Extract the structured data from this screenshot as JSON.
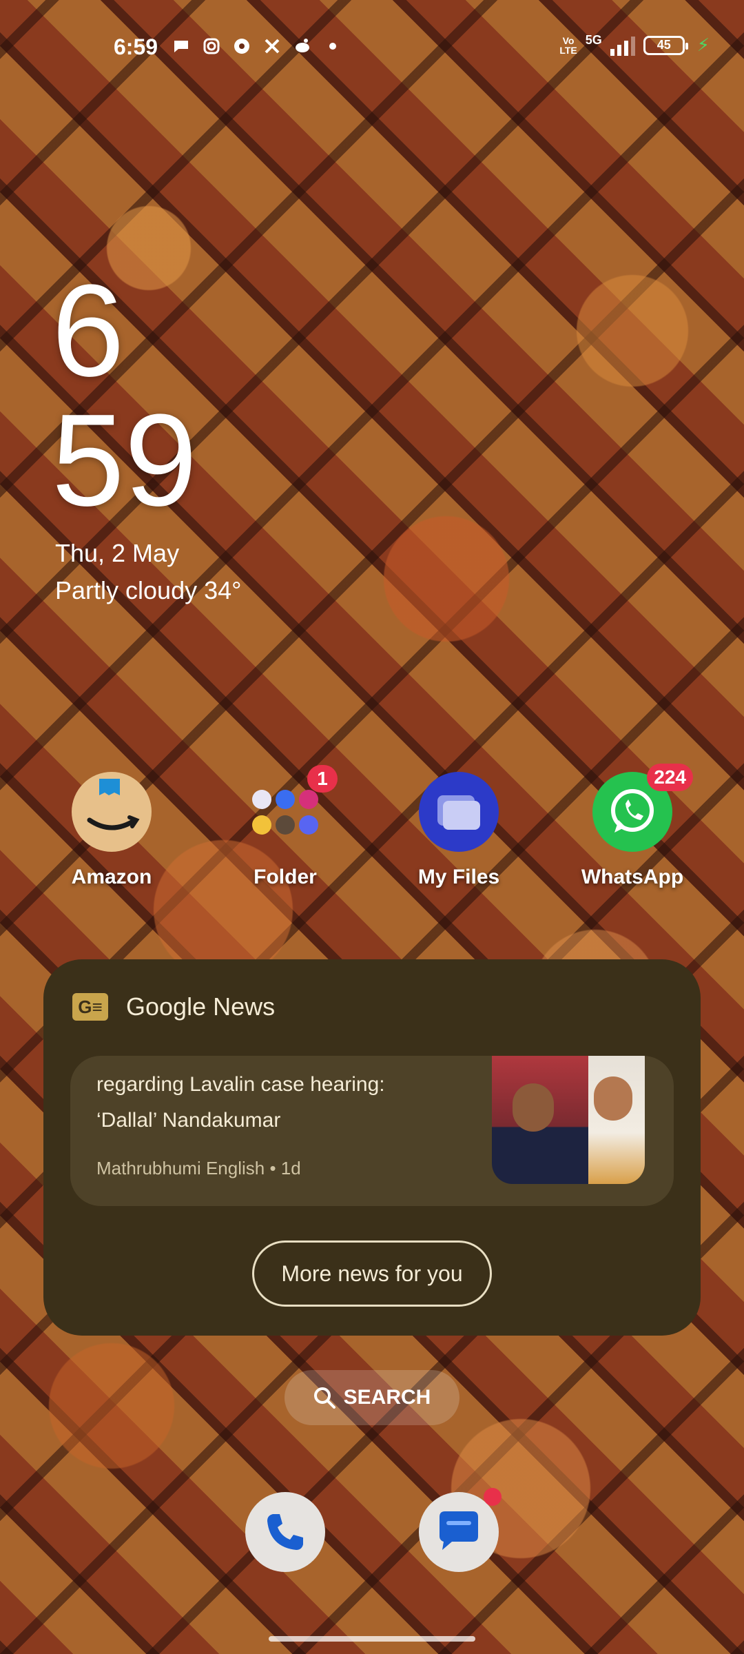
{
  "status_bar": {
    "time": "6:59",
    "network_label": "5G",
    "volte_line1": "Vo",
    "volte_line2": "LTE",
    "battery": "45"
  },
  "clock_widget": {
    "hour": "6",
    "minute": "59",
    "date": "Thu, 2 May",
    "weather": "Partly cloudy  34°"
  },
  "apps": [
    {
      "label": "Amazon",
      "icon": "amazon-icon",
      "badge": ""
    },
    {
      "label": "Folder",
      "icon": "folder-icon",
      "badge": "1"
    },
    {
      "label": "My Files",
      "icon": "files-icon",
      "badge": ""
    },
    {
      "label": "WhatsApp",
      "icon": "whatsapp-icon",
      "badge": "224"
    }
  ],
  "news_widget": {
    "title": "Google News",
    "headline_line1": "regarding Lavalin case hearing:",
    "headline_line2": "‘Dallal’ Nandakumar",
    "source": "Mathrubhumi English • 1d",
    "more_button": "More news for you"
  },
  "search": {
    "label": "SEARCH"
  },
  "dock": [
    {
      "icon": "phone-icon"
    },
    {
      "icon": "messages-icon"
    }
  ],
  "colors": {
    "news_bg": "#3b3019",
    "badge_red": "#e8304a",
    "whatsapp_green": "#25c24f",
    "myfiles_blue": "#2c3ac8"
  }
}
